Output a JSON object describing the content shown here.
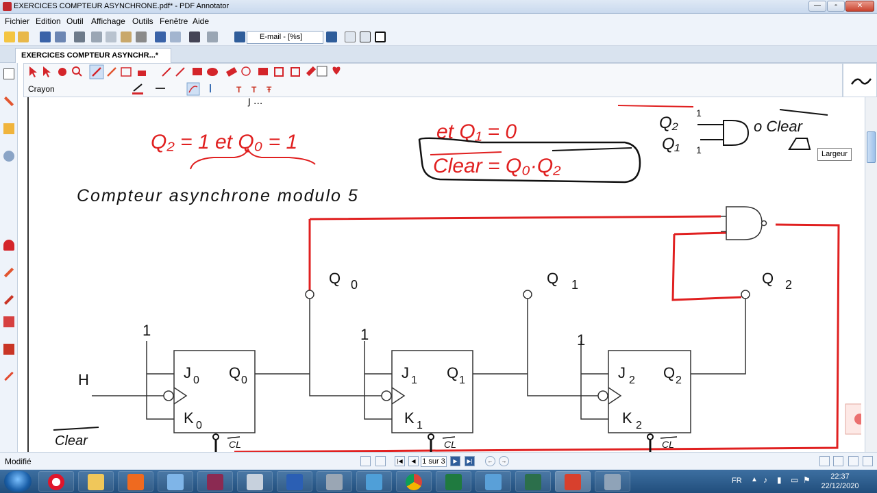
{
  "window": {
    "title": "EXERCICES COMPTEUR ASYNCHRONE.pdf* - PDF Annotator",
    "minimize": "—",
    "restore": "▫",
    "close": "✕"
  },
  "menu": [
    "Fichier",
    "Edition",
    "Outil",
    "Affichage",
    "Outils",
    "Fenêtre",
    "Aide"
  ],
  "toolbar": {
    "zoom_value": "E-mail - [%s]"
  },
  "tab": {
    "label": "EXERCICES COMPTEUR ASYNCHR...*"
  },
  "annotation_toolbar": {
    "tool_label": "Crayon"
  },
  "tooltip": "Largeur",
  "status": {
    "text": "Modifié",
    "page": "1 sur 3"
  },
  "taskbar": {
    "lang": "FR",
    "time": "22:37",
    "date": "22/12/2020"
  },
  "document": {
    "handwriting": {
      "top_cut": "j ... ",
      "q2_q0": "Q₂ = 1   et Q₀ = 1",
      "et_q1": "et Q₁ = 0",
      "clear_eq": "Clear = Q₀·Q₂",
      "q2": "Q₂",
      "q1_h": "Q₁",
      "one_1": "1",
      "one_2": "1",
      "clear_nand": "o Clear",
      "heading": "Compteur asynchrone modulo 5",
      "clear_bottom": "Clear",
      "cl_0": "CL",
      "cl_1": "CL",
      "cl_2": "CL"
    },
    "printed": {
      "q0_label": "Q",
      "q0_sub": "0",
      "q1_label": "Q",
      "q1_sub": "1",
      "q2_label": "Q",
      "q2_sub": "2",
      "h_label": "H",
      "one_a": "1",
      "one_b": "1",
      "one_c": "1",
      "ff0_j": "J",
      "ff0_j_sub": "0",
      "ff0_q": "Q",
      "ff0_q_sub": "0",
      "ff0_k": "K",
      "ff0_k_sub": "0",
      "ff1_j": "J",
      "ff1_j_sub": "1",
      "ff1_q": "Q",
      "ff1_q_sub": "1",
      "ff1_k": "K",
      "ff1_k_sub": "1",
      "ff2_j": "J",
      "ff2_j_sub": "2",
      "ff2_q": "Q",
      "ff2_q_sub": "2",
      "ff2_k": "K",
      "ff2_k_sub": "2"
    }
  },
  "colors": {
    "ink_red": "#e02020",
    "ink_black": "#111111",
    "accent": "#c0282d"
  }
}
